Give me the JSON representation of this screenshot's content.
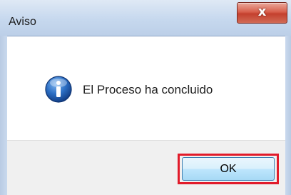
{
  "window": {
    "title": "Aviso",
    "close_glyph": "x"
  },
  "dialog": {
    "icon": "info-icon",
    "message": "El Proceso ha concluido"
  },
  "buttons": {
    "ok_label": "OK"
  },
  "colors": {
    "highlight_border": "#e11b2a",
    "close_button": "#c4402e",
    "icon_blue": "#1f5fb2"
  }
}
